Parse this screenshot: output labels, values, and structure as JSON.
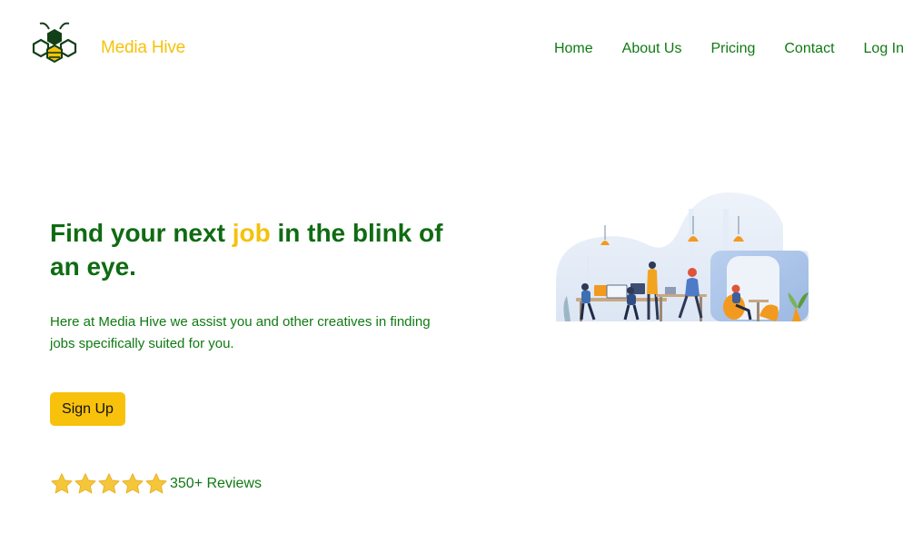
{
  "header": {
    "brand": "Media Hive",
    "logo_icon": "bee-hive-logo-icon",
    "nav": [
      {
        "label": "Home"
      },
      {
        "label": "About Us"
      },
      {
        "label": "Pricing"
      },
      {
        "label": "Contact"
      },
      {
        "label": "Log In"
      }
    ]
  },
  "hero": {
    "title_before": "Find your next ",
    "title_accent": "job",
    "title_after": " in the blink of an eye.",
    "description": "Here at Media Hive we assist you and other creatives in finding jobs specifically suited for you.",
    "signup_label": "Sign Up",
    "illustration_icon": "office-team-illustration"
  },
  "reviews": {
    "rating_stars": 5,
    "rating_max": 5,
    "label": "350+ Reviews"
  },
  "colors": {
    "primary_green": "#0F7A12",
    "title_green": "#0F6B12",
    "accent_yellow": "#F5C20B",
    "button_yellow": "#F8C20C",
    "background": "#FFFFFF"
  }
}
